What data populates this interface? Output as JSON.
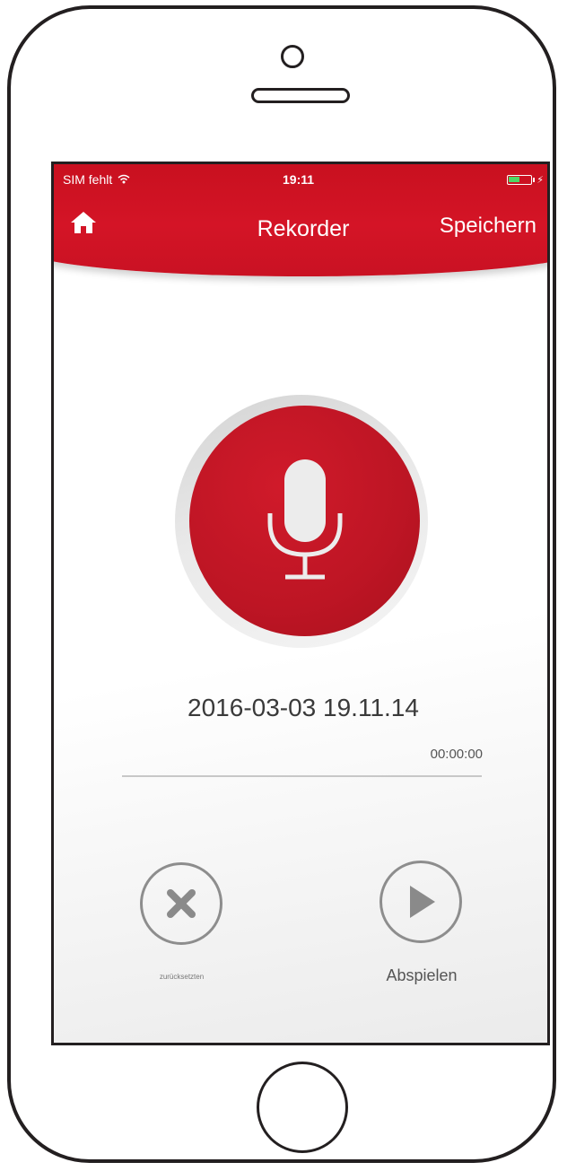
{
  "status_bar": {
    "carrier": "SIM fehlt",
    "time": "19:11",
    "battery_level": 0.55
  },
  "nav": {
    "title": "Rekorder",
    "save_label": "Speichern"
  },
  "recording": {
    "name": "2016-03-03 19.11.14",
    "elapsed": "00:00:00",
    "progress": 0
  },
  "controls": {
    "reset_label": "zurücksetzten",
    "play_label": "Abspielen"
  },
  "colors": {
    "accent": "#c8101f",
    "battery": "#4cd964"
  },
  "icons": [
    "wifi-icon",
    "battery-icon",
    "home-icon",
    "microphone-icon",
    "close-icon",
    "play-icon"
  ]
}
